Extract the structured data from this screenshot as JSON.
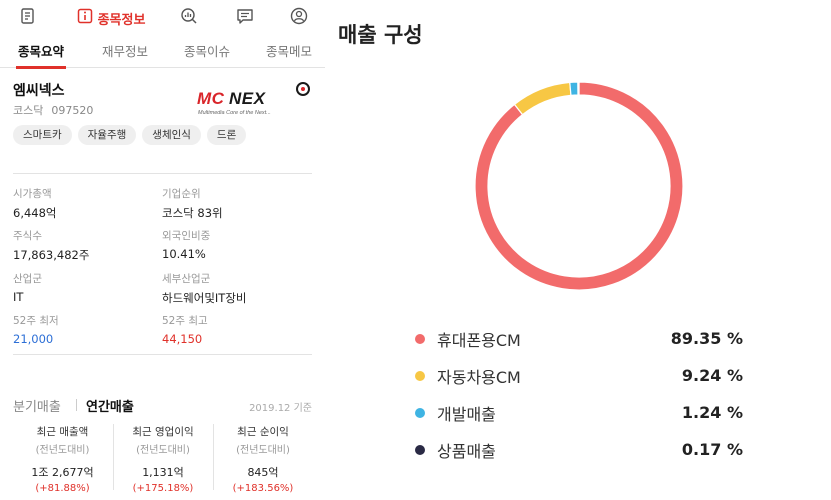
{
  "topnav": {
    "info_label": "종목정보",
    "icons": [
      "document-icon",
      "info-icon",
      "chart-search-icon",
      "message-icon",
      "user-icon"
    ],
    "accent": "#e0312a"
  },
  "subtabs": [
    "종목요약",
    "재무정보",
    "종목이슈",
    "종목메모"
  ],
  "stock": {
    "name": "엠씨넥스",
    "market": "코스닥",
    "code": "097520",
    "logo_text": "MCNEX",
    "logo_tagline": "Multimedia Core of the Next..."
  },
  "tags": [
    "스마트카",
    "자율주행",
    "생체인식",
    "드론"
  ],
  "info": [
    {
      "label": "시가총액",
      "value": "6,448억"
    },
    {
      "label": "기업순위",
      "value": "코스닥 83위"
    },
    {
      "label": "주식수",
      "value": "17,863,482주"
    },
    {
      "label": "외국인비중",
      "value": "10.41%"
    },
    {
      "label": "산업군",
      "value": "IT"
    },
    {
      "label": "세부산업군",
      "value": "하드웨어및IT장비"
    },
    {
      "label": "52주 최저",
      "value": "21,000"
    },
    {
      "label": "52주 최고",
      "value": "44,150"
    }
  ],
  "sales": {
    "tab_quarter": "분기매출",
    "tab_annual": "연간매출",
    "date": "2019.12 기준",
    "metrics": [
      {
        "title": "최근 매출액",
        "sub": "(전년도대비)",
        "value": "1조 2,677억",
        "pct": "(+81.88%)"
      },
      {
        "title": "최근 영업이익",
        "sub": "(전년도대비)",
        "value": "1,131억",
        "pct": "(+175.18%)"
      },
      {
        "title": "최근 순이익",
        "sub": "(전년도대비)",
        "value": "845억",
        "pct": "(+183.56%)"
      }
    ]
  },
  "revenue": {
    "title": "매출 구성",
    "items": [
      {
        "label": "휴대폰용CM",
        "pct_text": "89.35 %",
        "value": 89.35,
        "color": "#f26b6b"
      },
      {
        "label": "자동차용CM",
        "pct_text": "9.24 %",
        "value": 9.24,
        "color": "#f7c744"
      },
      {
        "label": "개발매출",
        "pct_text": "1.24 %",
        "value": 1.24,
        "color": "#3fb4e3"
      },
      {
        "label": "상품매출",
        "pct_text": "0.17 %",
        "value": 0.17,
        "color": "#2a2a45"
      }
    ]
  }
}
